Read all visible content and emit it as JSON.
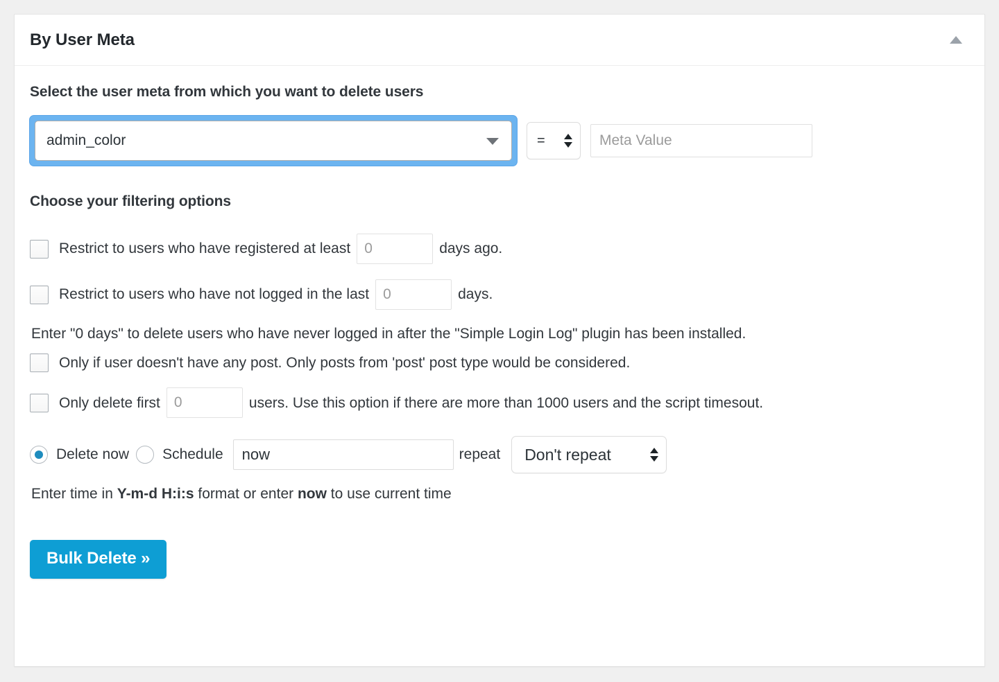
{
  "panel": {
    "title": "By User Meta",
    "toggle_icon": "caret-up-icon"
  },
  "meta": {
    "heading": "Select the user meta from which you want to delete users",
    "meta_key_selected": "admin_color",
    "operator_selected": "=",
    "meta_value_placeholder": "Meta Value",
    "meta_value": ""
  },
  "filters": {
    "heading": "Choose your filtering options",
    "registered": {
      "label_before": "Restrict to users who have registered at least",
      "input_placeholder": "0",
      "input_value": "",
      "label_after": "days ago."
    },
    "not_logged_in": {
      "label_before": "Restrict to users who have not logged in the last",
      "input_placeholder": "0",
      "input_value": "",
      "label_after": "days."
    },
    "login_note": "Enter \"0 days\" to delete users who have never logged in after the \"Simple Login Log\" plugin has been installed.",
    "no_posts": {
      "label": "Only if user doesn't have any post. Only posts from 'post' post type would be considered."
    },
    "limit": {
      "label_before": "Only delete first",
      "input_placeholder": "0",
      "input_value": "",
      "label_after": "users. Use this option if there are more than 1000 users and the script timesout."
    }
  },
  "schedule": {
    "delete_now_label": "Delete now",
    "delete_now_selected": true,
    "schedule_label": "Schedule",
    "schedule_selected": false,
    "time_value": "now",
    "repeat_label": "repeat",
    "repeat_selected": "Don't repeat",
    "hint_prefix": "Enter time in ",
    "hint_format": "Y-m-d H:i:s",
    "hint_middle": " format or enter ",
    "hint_now": "now",
    "hint_suffix": " to use current time"
  },
  "actions": {
    "submit_label": "Bulk Delete »"
  },
  "colors": {
    "accent": "#0e9ed4",
    "focus_ring": "#6cb4f0",
    "radio_dot": "#1e8cbe",
    "text": "#32373c",
    "page_bg": "#f0f0f0"
  }
}
